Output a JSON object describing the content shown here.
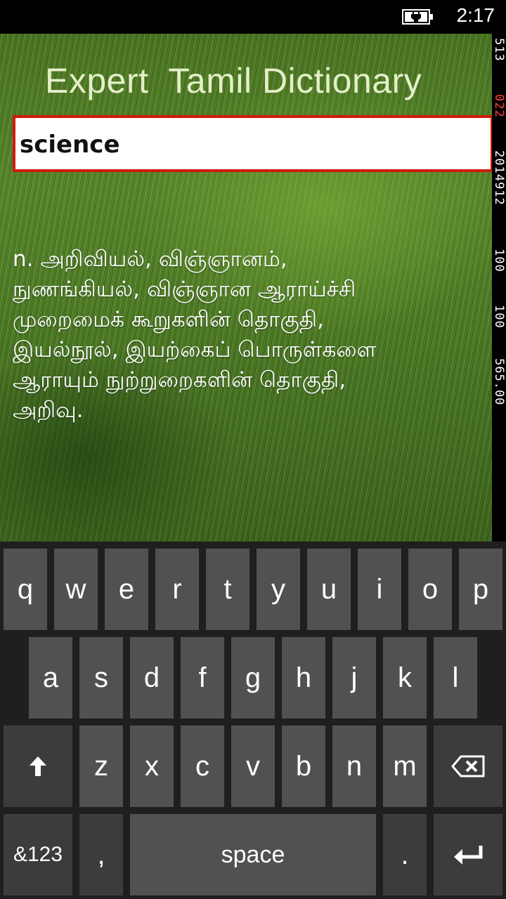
{
  "status": {
    "time": "2:17",
    "icon": "battery-charging-icon"
  },
  "app": {
    "title": "Expert  Tamil Dictionary"
  },
  "search": {
    "value": "science"
  },
  "definition": {
    "lines": [
      "n. அறிவியல், விஞ்ஞானம்,",
      "நுணங்கியல், விஞ்ஞான ஆராய்ச்சி",
      "முறைமைக்  கூறுகளின் தொகுதி,",
      "இயல்நூல், இயற்கைப் பொருள்களை",
      "ஆராயும் நுற்றுறைகளின் தொகுதி,",
      "அறிவு."
    ]
  },
  "side_counters": [
    "513",
    "022",
    "2014912",
    "100",
    "100",
    "565.00"
  ],
  "keyboard": {
    "row1": [
      "q",
      "w",
      "e",
      "r",
      "t",
      "y",
      "u",
      "i",
      "o",
      "p"
    ],
    "row2": [
      "a",
      "s",
      "d",
      "f",
      "g",
      "h",
      "j",
      "k",
      "l"
    ],
    "row3": [
      "z",
      "x",
      "c",
      "v",
      "b",
      "n",
      "m"
    ],
    "shift_icon": "shift-arrow-icon",
    "backspace_icon": "backspace-icon",
    "enter_icon": "enter-icon",
    "numbers_label": "&123",
    "comma_label": ",",
    "space_label": "space",
    "period_label": "."
  }
}
